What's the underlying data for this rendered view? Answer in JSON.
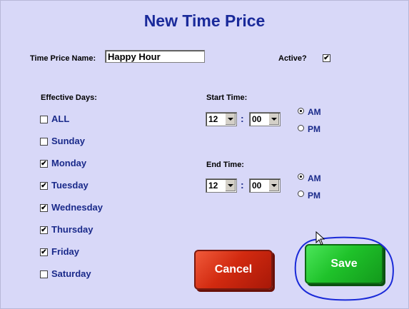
{
  "title": "New Time Price",
  "form": {
    "name_label": "Time Price Name:",
    "name_value": "Happy Hour",
    "active_label": "Active?",
    "active_checked": true
  },
  "days": {
    "header": "Effective Days:",
    "items": [
      {
        "label": "ALL",
        "checked": false
      },
      {
        "label": "Sunday",
        "checked": false
      },
      {
        "label": "Monday",
        "checked": true
      },
      {
        "label": "Tuesday",
        "checked": true
      },
      {
        "label": "Wednesday",
        "checked": true
      },
      {
        "label": "Thursday",
        "checked": true
      },
      {
        "label": "Friday",
        "checked": true
      },
      {
        "label": "Saturday",
        "checked": false
      }
    ]
  },
  "start_time": {
    "label": "Start Time:",
    "hour": "12",
    "minute": "00",
    "colon": ":",
    "am_label": "AM",
    "pm_label": "PM",
    "selected": "AM"
  },
  "end_time": {
    "label": "End Time:",
    "hour": "12",
    "minute": "00",
    "colon": ":",
    "am_label": "AM",
    "pm_label": "PM",
    "selected": "AM"
  },
  "buttons": {
    "cancel": "Cancel",
    "save": "Save"
  },
  "colors": {
    "background": "#d8d8f8",
    "title": "#1a2a9a",
    "cancel": "#d22a10",
    "save": "#1fc22a",
    "annotation": "#1a2ad8"
  }
}
